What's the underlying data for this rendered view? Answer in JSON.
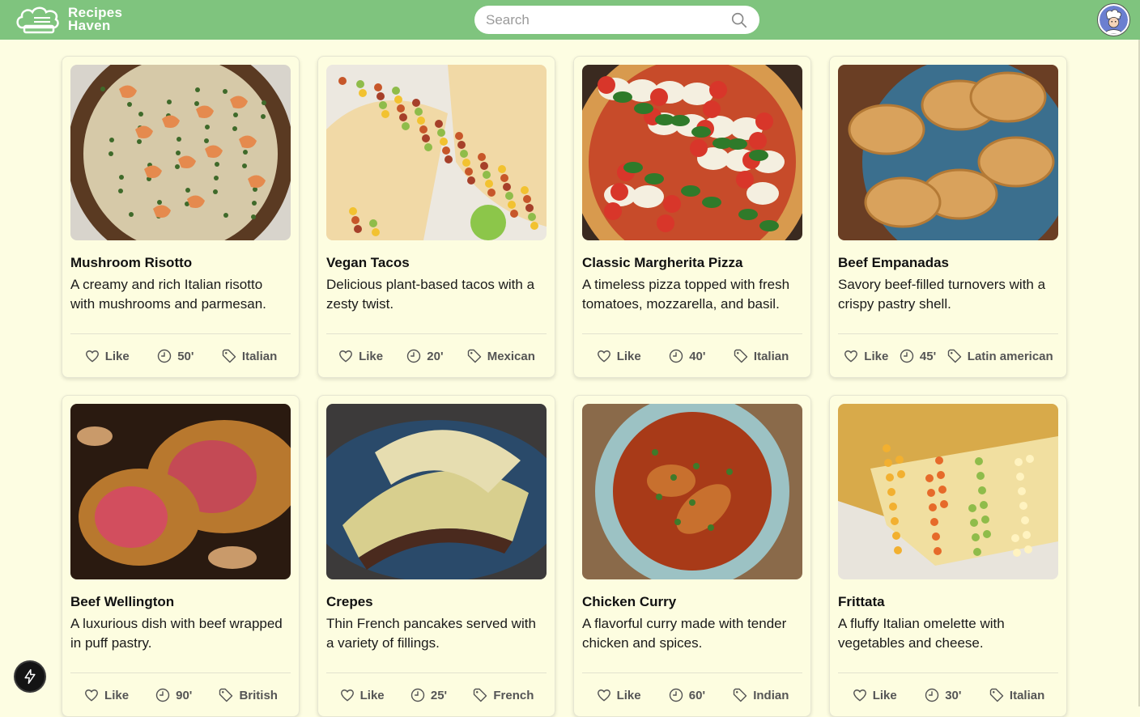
{
  "header": {
    "logo_line1": "Recipes",
    "logo_line2": "Haven",
    "search_placeholder": "Search",
    "color": "#7fc47e"
  },
  "like_label": "Like",
  "recipes": [
    {
      "title": "Mushroom Risotto",
      "desc": "A creamy and rich Italian risotto with mushrooms and parmesan.",
      "time": "50'",
      "cuisine": "Italian",
      "image": "risotto"
    },
    {
      "title": "Vegan Tacos",
      "desc": "Delicious plant-based tacos with a zesty twist.",
      "time": "20'",
      "cuisine": "Mexican",
      "image": "tacos"
    },
    {
      "title": "Classic Margherita Pizza",
      "desc": "A timeless pizza topped with fresh tomatoes, mozzarella, and basil.",
      "time": "40'",
      "cuisine": "Italian",
      "image": "pizza"
    },
    {
      "title": "Beef Empanadas",
      "desc": "Savory beef-filled turnovers with a crispy pastry shell.",
      "time": "45'",
      "cuisine": "Latin american",
      "image": "empanadas"
    },
    {
      "title": "Beef Wellington",
      "desc": "A luxurious dish with beef wrapped in puff pastry.",
      "time": "90'",
      "cuisine": "British",
      "image": "wellington"
    },
    {
      "title": "Crepes",
      "desc": "Thin French pancakes served with a variety of fillings.",
      "time": "25'",
      "cuisine": "French",
      "image": "crepes"
    },
    {
      "title": "Chicken Curry",
      "desc": "A flavorful curry made with tender chicken and spices.",
      "time": "60'",
      "cuisine": "Indian",
      "image": "curry"
    },
    {
      "title": "Frittata",
      "desc": "A fluffy Italian omelette with vegetables and cheese.",
      "time": "30'",
      "cuisine": "Italian",
      "image": "frittata"
    }
  ]
}
